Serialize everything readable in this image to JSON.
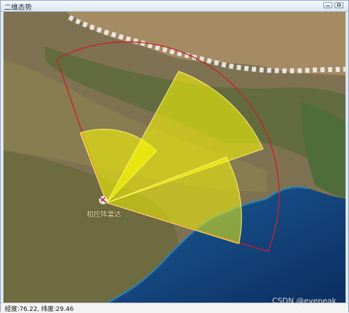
{
  "window": {
    "title": "二维态势"
  },
  "map": {
    "radar_label": "相控阵雷达",
    "sector_fill": "#ffff00",
    "range_ring_color": "#cc1f2a"
  },
  "status": {
    "coordinates": "经度:76.22, 纬度:29.46"
  },
  "watermark": "CSDN @eyepeak"
}
